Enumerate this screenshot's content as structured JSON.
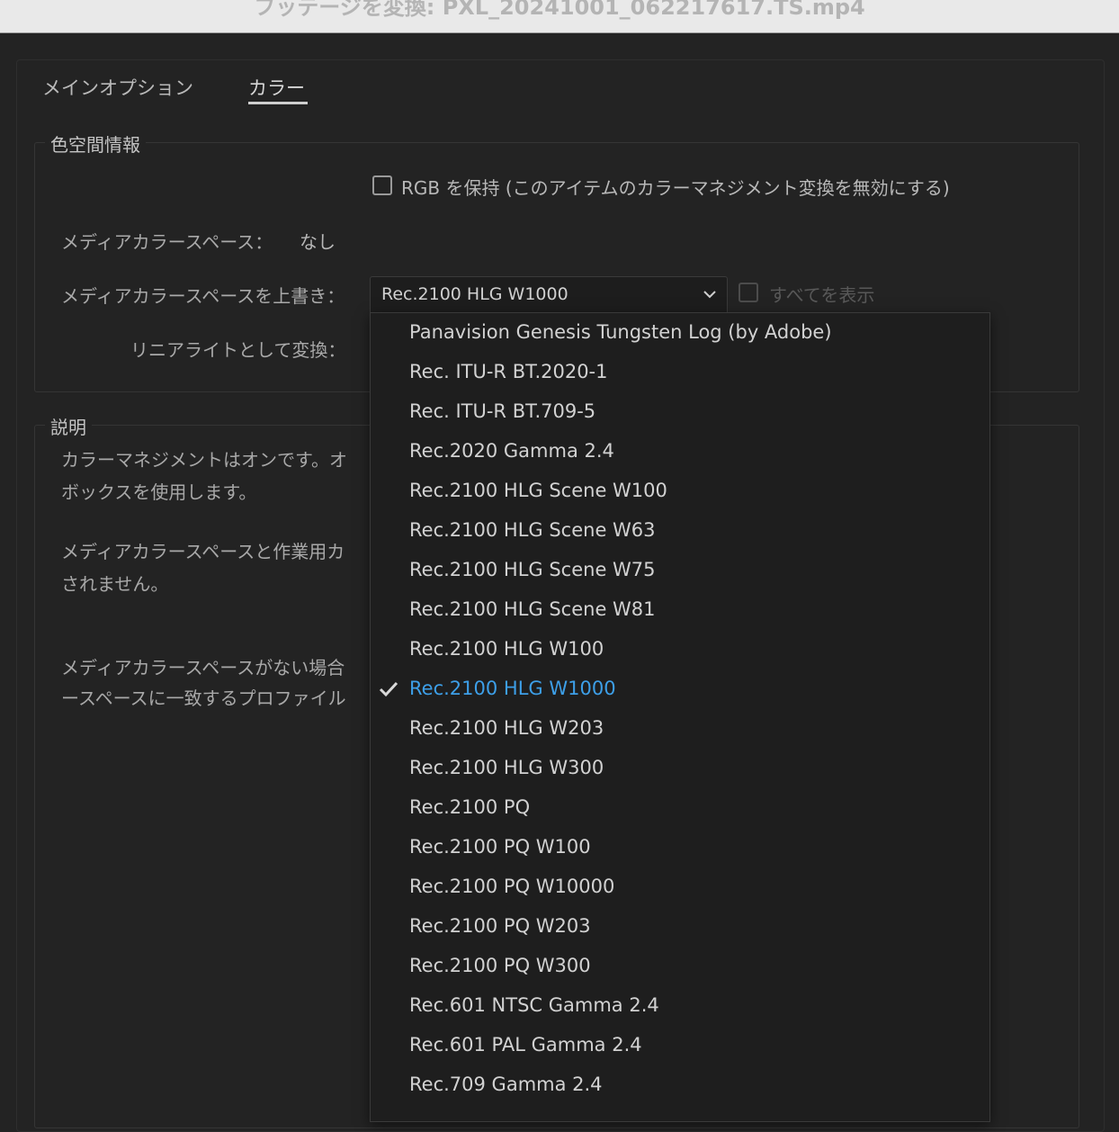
{
  "window": {
    "title": "フッテージを変換: PXL_20241001_062217617.TS.mp4"
  },
  "tabs": [
    {
      "label": "メインオプション",
      "active": false
    },
    {
      "label": "カラー",
      "active": true
    }
  ],
  "color_space_info": {
    "group_label": "色空間情報",
    "preserve_rgb_label": "RGB を保持 (このアイテムのカラーマネジメント変換を無効にする)",
    "preserve_rgb_checked": false,
    "media_color_space_label": "メディアカラースペース：",
    "media_color_space_value": "なし",
    "override_label": "メディアカラースペースを上書き：",
    "override_selected": "Rec.2100 HLG W1000",
    "show_all_label": "すべてを表示",
    "show_all_checked": false,
    "linear_light_label": "リニアライトとして変換："
  },
  "description": {
    "group_label": "説明",
    "para1_line1": "カラーマネジメントはオンです。オ",
    "para1_line2": "ボックスを使用します。",
    "para2_line1": "メディアカラースペースと作業用カ",
    "para2_line2": "されません。",
    "para3_line1": "メディアカラースペースがない場合",
    "para3_line2": "ースペースに一致するプロファイル"
  },
  "dropdown": {
    "options": [
      "Panavision Genesis Tungsten Log (by Adobe)",
      "Rec. ITU-R BT.2020-1",
      "Rec. ITU-R BT.709-5",
      "Rec.2020 Gamma 2.4",
      "Rec.2100 HLG Scene W100",
      "Rec.2100 HLG Scene W63",
      "Rec.2100 HLG Scene W75",
      "Rec.2100 HLG Scene W81",
      "Rec.2100 HLG W100",
      "Rec.2100 HLG W1000",
      "Rec.2100 HLG W203",
      "Rec.2100 HLG W300",
      "Rec.2100 PQ",
      "Rec.2100 PQ W100",
      "Rec.2100 PQ W10000",
      "Rec.2100 PQ W203",
      "Rec.2100 PQ W300",
      "Rec.601 NTSC Gamma 2.4",
      "Rec.601 PAL Gamma 2.4",
      "Rec.709 Gamma 2.4"
    ],
    "selected_index": 9
  },
  "colors": {
    "background": "#232323",
    "titlebar": "#e9e9e9",
    "accent_selected": "#3d9fe8"
  }
}
